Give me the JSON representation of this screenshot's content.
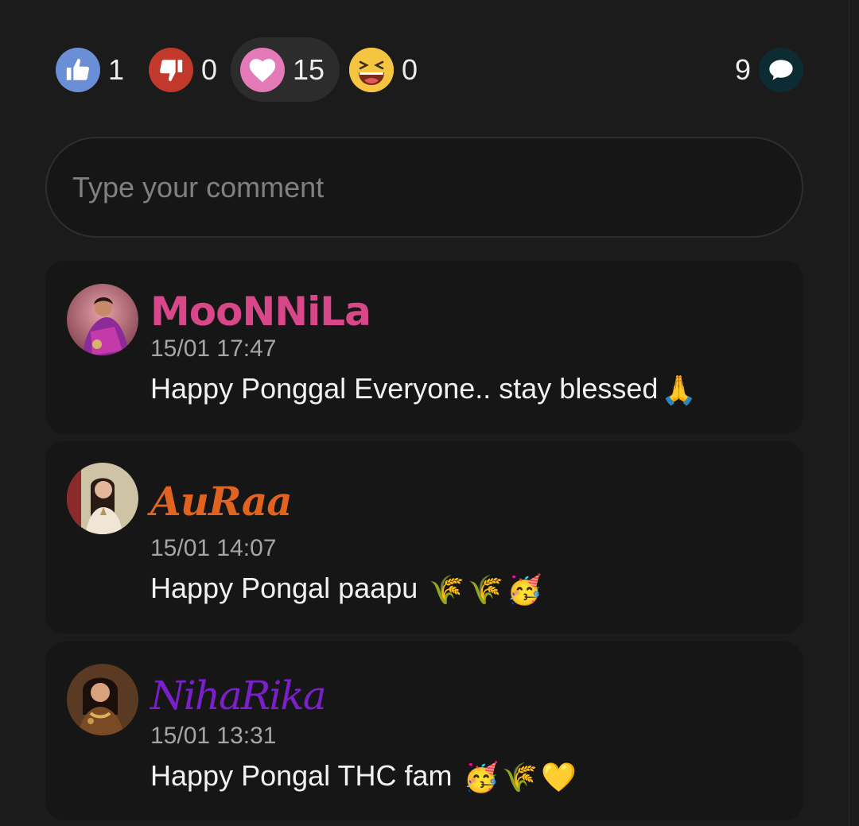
{
  "reactions": {
    "like": {
      "icon": "thumbs-up-icon",
      "count": "1",
      "color": "#6b8fd6"
    },
    "dislike": {
      "icon": "thumbs-down-icon",
      "count": "0",
      "color": "#c0392b"
    },
    "love": {
      "icon": "heart-icon",
      "count": "15",
      "color": "#e47ab8"
    },
    "laugh": {
      "icon": "laughing-face-icon",
      "count": "0",
      "color": "#f5c542"
    }
  },
  "comment_count": {
    "count": "9",
    "icon": "speech-bubble-icon"
  },
  "comment_input": {
    "placeholder": "Type your comment"
  },
  "comments": [
    {
      "username": "MooNNiLa",
      "time": "15/01 17:47",
      "text": "Happy Ponggal Everyone.. stay blessed",
      "emojis": [
        "🙏"
      ],
      "name_color": "#d8478a"
    },
    {
      "username": "AuRaa",
      "time": "15/01 14:07",
      "text": "Happy Pongal paapu ",
      "emojis": [
        "🌾",
        "🌾",
        "🥳"
      ],
      "name_color": "#e0641f"
    },
    {
      "username": "NihaRika",
      "time": "15/01 13:31",
      "text": "Happy Pongal THC fam ",
      "emojis": [
        "🥳",
        "🌾",
        "💛"
      ],
      "name_color": "#7a1fc9"
    }
  ]
}
